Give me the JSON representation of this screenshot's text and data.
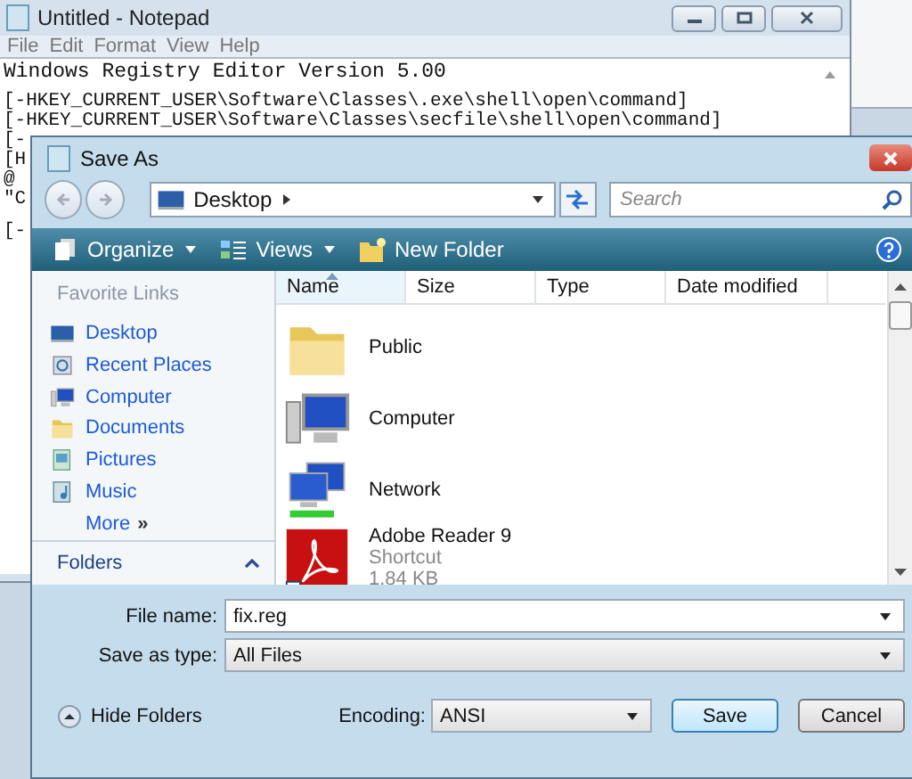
{
  "notepad": {
    "title": "Untitled - Notepad",
    "menu": [
      "File",
      "Edit",
      "Format",
      "View",
      "Help"
    ],
    "blocks": [
      [
        "Windows Registry Editor Version 5.00"
      ],
      [
        "[-HKEY_CURRENT_USER\\Software\\Classes\\.exe\\shell\\open\\command]",
        "[-HKEY_CURRENT_USER\\Software\\Classes\\secfile\\shell\\open\\command]",
        "[-",
        "[H",
        "@",
        "\"C"
      ],
      [
        "[-"
      ]
    ]
  },
  "dialog": {
    "title": "Save As",
    "address": "Desktop",
    "search": {
      "placeholder": "Search"
    },
    "toolbar": [
      {
        "label": "Organize",
        "kind": "menu"
      },
      {
        "label": "Views",
        "kind": "menu"
      },
      {
        "label": "New Folder",
        "kind": "button"
      }
    ],
    "favorites_title": "Favorite Links",
    "favorites": [
      {
        "label": "Desktop",
        "kind": "desktop"
      },
      {
        "label": "Recent Places",
        "kind": "recent"
      },
      {
        "label": "Computer",
        "kind": "computer"
      },
      {
        "label": "Documents",
        "kind": "folder"
      },
      {
        "label": "Pictures",
        "kind": "pictures"
      },
      {
        "label": "Music",
        "kind": "music"
      }
    ],
    "more": "More",
    "more_icon": "»",
    "folders": "Folders",
    "columns": [
      {
        "label": "Name",
        "sorted": true
      },
      {
        "label": "Size",
        "sorted": false
      },
      {
        "label": "Type",
        "sorted": false
      },
      {
        "label": "Date modified",
        "sorted": false
      }
    ],
    "files": [
      {
        "name": "Public",
        "kind": "folder"
      },
      {
        "name": "Computer",
        "kind": "computer"
      },
      {
        "name": "Network",
        "kind": "network"
      },
      {
        "name": "Adobe Reader 9",
        "kind": "shortcut",
        "details": [
          "Shortcut",
          "1.84 KB"
        ]
      }
    ],
    "file_name": {
      "label": "File name:",
      "value": "fix.reg"
    },
    "save_type": {
      "label": "Save as type:",
      "value": "All Files"
    },
    "hide_folders": "Hide Folders",
    "encoding": {
      "label": "Encoding:",
      "value": "ANSI"
    },
    "buttons": [
      {
        "label": "Save",
        "default": true
      },
      {
        "label": "Cancel",
        "default": false
      }
    ]
  }
}
